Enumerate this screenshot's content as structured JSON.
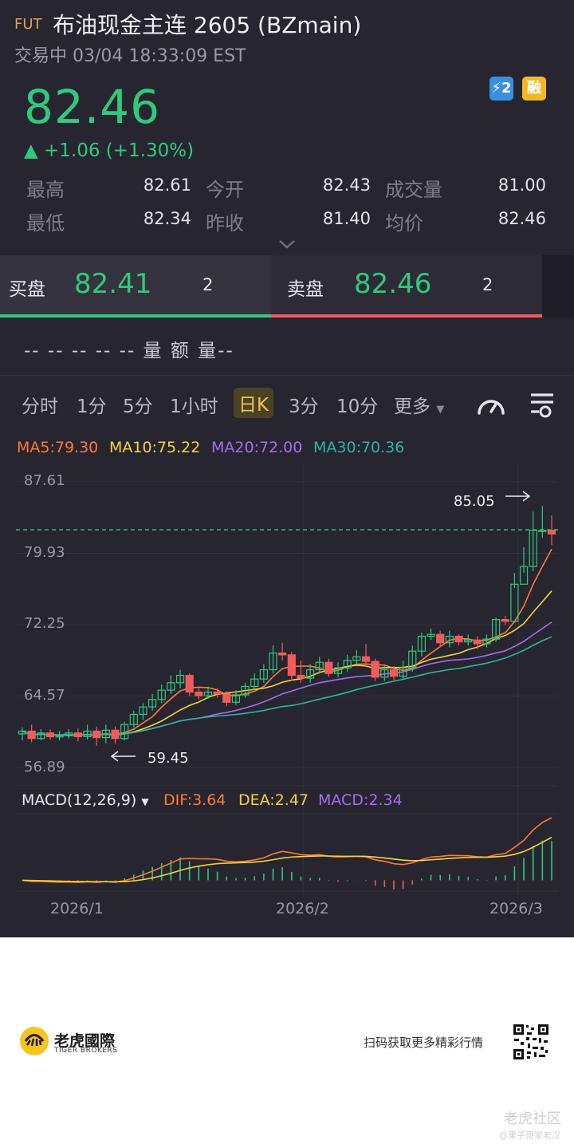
{
  "header": {
    "tag": "FUT",
    "title": "布油现金主连 2605 (BZmain)",
    "status": "交易中 03/04 18:33:09 EST"
  },
  "quote": {
    "price": "82.46",
    "change": "▲ +1.06 (+1.30%)",
    "badges": [
      "⚡2",
      "融"
    ],
    "stats": [
      {
        "label": "最高",
        "value": "82.61"
      },
      {
        "label": "今开",
        "value": "82.43"
      },
      {
        "label": "成交量",
        "value": "81.00"
      },
      {
        "label": "最低",
        "value": "82.34"
      },
      {
        "label": "昨收",
        "value": "81.40"
      },
      {
        "label": "均价",
        "value": "82.46"
      }
    ]
  },
  "orderbook": {
    "bid_label": "买盘",
    "bid_price": "82.41",
    "bid_qty": "2",
    "ask_label": "卖盘",
    "ask_price": "82.46",
    "ask_qty": "2"
  },
  "volume_row": "-- -- -- -- --  量   额 量--",
  "tabs": [
    "分时",
    "1分",
    "5分",
    "1小时",
    "日K",
    "3分",
    "10分",
    "更多"
  ],
  "active_tab": "日K",
  "ma_legend": [
    {
      "text": "MA5:79.30",
      "color": "#ff7a35"
    },
    {
      "text": "MA10:75.22",
      "color": "#f7d33b"
    },
    {
      "text": "MA20:72.00",
      "color": "#a96cf0"
    },
    {
      "text": "MA30:70.36",
      "color": "#2fb59d"
    }
  ],
  "macd_legend": {
    "name": "MACD(12,26,9)",
    "dif": "DIF:3.64",
    "dea": "DEA:2.47",
    "macd": "MACD:2.34"
  },
  "chart_data": {
    "type": "candlestick",
    "y_ticks": [
      "87.61",
      "79.93",
      "72.25",
      "64.57",
      "56.89"
    ],
    "ylim": [
      56.89,
      87.61
    ],
    "x_ticks": [
      "2026/1",
      "2026/2",
      "2026/3"
    ],
    "high_label": "85.05",
    "low_label": "59.45",
    "last_price": 82.46,
    "candles": [
      [
        60.5,
        60.8,
        59.8,
        61.2
      ],
      [
        60.8,
        60.0,
        59.6,
        61.5
      ],
      [
        60.0,
        60.6,
        59.8,
        61.0
      ],
      [
        60.6,
        60.2,
        59.9,
        61.0
      ],
      [
        60.2,
        60.3,
        59.8,
        60.8
      ],
      [
        60.3,
        60.6,
        60.0,
        61.0
      ],
      [
        60.6,
        60.2,
        59.7,
        61.1
      ],
      [
        60.2,
        60.8,
        59.9,
        61.5
      ],
      [
        60.8,
        60.1,
        59.2,
        61.3
      ],
      [
        60.1,
        60.9,
        59.5,
        61.5
      ],
      [
        60.9,
        60.0,
        59.45,
        61.3
      ],
      [
        60.0,
        61.5,
        59.8,
        61.8
      ],
      [
        61.5,
        62.6,
        61.2,
        63.0
      ],
      [
        62.6,
        63.4,
        62.0,
        63.8
      ],
      [
        63.4,
        64.2,
        63.0,
        64.8
      ],
      [
        64.2,
        65.2,
        63.8,
        65.8
      ],
      [
        65.2,
        66.0,
        64.8,
        66.8
      ],
      [
        66.0,
        66.8,
        65.4,
        67.4
      ],
      [
        66.8,
        65.0,
        64.6,
        67.0
      ],
      [
        65.0,
        64.6,
        64.2,
        65.4
      ],
      [
        64.6,
        65.0,
        64.3,
        65.6
      ],
      [
        65.0,
        64.8,
        64.4,
        65.4
      ],
      [
        64.8,
        63.9,
        63.5,
        65.1
      ],
      [
        63.9,
        64.7,
        63.6,
        65.2
      ],
      [
        64.7,
        65.6,
        64.4,
        66.0
      ],
      [
        65.6,
        66.4,
        65.2,
        67.0
      ],
      [
        66.4,
        67.4,
        66.0,
        68.0
      ],
      [
        67.4,
        69.2,
        67.0,
        70.0
      ],
      [
        69.2,
        69.0,
        68.4,
        70.3
      ],
      [
        69.0,
        66.8,
        66.2,
        69.3
      ],
      [
        66.8,
        66.5,
        66.0,
        68.4
      ],
      [
        66.5,
        67.4,
        66.0,
        68.0
      ],
      [
        67.4,
        68.2,
        67.0,
        68.8
      ],
      [
        68.2,
        67.0,
        66.6,
        68.6
      ],
      [
        67.0,
        67.6,
        66.6,
        68.2
      ],
      [
        67.6,
        68.4,
        67.2,
        69.0
      ],
      [
        68.4,
        68.8,
        68.0,
        69.5
      ],
      [
        68.8,
        68.3,
        67.8,
        70.2
      ],
      [
        68.3,
        66.6,
        66.2,
        68.6
      ],
      [
        66.6,
        67.4,
        66.2,
        67.8
      ],
      [
        67.4,
        66.7,
        66.3,
        67.8
      ],
      [
        66.7,
        67.6,
        66.4,
        68.4
      ],
      [
        67.6,
        69.4,
        67.2,
        70.0
      ],
      [
        69.4,
        71.0,
        68.8,
        71.4
      ],
      [
        71.0,
        71.2,
        70.6,
        71.8
      ],
      [
        71.2,
        70.3,
        69.8,
        71.6
      ],
      [
        70.3,
        71.0,
        69.8,
        71.6
      ],
      [
        71.0,
        70.4,
        70.0,
        71.2
      ],
      [
        70.4,
        70.6,
        70.0,
        71.2
      ],
      [
        70.6,
        70.2,
        69.6,
        71.0
      ],
      [
        70.2,
        70.7,
        69.8,
        71.2
      ],
      [
        70.7,
        72.8,
        70.4,
        73.0
      ],
      [
        72.8,
        72.6,
        72.2,
        73.2
      ],
      [
        72.6,
        76.6,
        76.2,
        77.8
      ],
      [
        76.6,
        78.5,
        77.8,
        80.6
      ],
      [
        78.5,
        82.4,
        78.0,
        84.4
      ],
      [
        82.4,
        82.4,
        81.6,
        85.05
      ],
      [
        82.4,
        82.0,
        80.8,
        84.0
      ]
    ],
    "ma_series": [
      {
        "name": "MA5",
        "color": "#ff7a35"
      },
      {
        "name": "MA10",
        "color": "#f7d33b"
      },
      {
        "name": "MA20",
        "color": "#a96cf0"
      },
      {
        "name": "MA30",
        "color": "#2fb59d"
      }
    ]
  },
  "footer": {
    "brand": "老虎國際",
    "brand_sub": "TIGER BROKERS",
    "cta": "扫码获取更多精彩行情",
    "watermark": "老虎社区",
    "watermark_sub": "@果子哥家老汉"
  },
  "colors": {
    "up": "#2fca7d",
    "down": "#f25b5b",
    "accent": "#f2c44a",
    "bg": "#262530"
  }
}
